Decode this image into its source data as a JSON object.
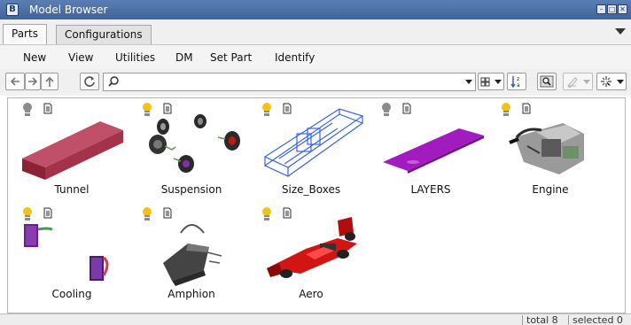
{
  "window": {
    "title": "Model Browser",
    "app_icon": "model-browser-app-icon"
  },
  "tabs": [
    {
      "label": "Parts",
      "active": true
    },
    {
      "label": "Configurations",
      "active": false
    }
  ],
  "menu": [
    "New",
    "View",
    "Utilities",
    "DM",
    "Set Part",
    "Identify"
  ],
  "toolbar": {
    "search_value": "",
    "search_placeholder": "",
    "icons": [
      "back-arrow-icon",
      "forward-arrow-icon",
      "up-arrow-icon",
      "refresh-icon",
      "search-icon",
      "view-mode-icon",
      "sort-az-icon",
      "find-in-model-icon",
      "display-style-icon",
      "selection-filter-icon"
    ]
  },
  "parts": [
    {
      "name": "Tunnel",
      "bulb_on": false,
      "thumb": "tunnel"
    },
    {
      "name": "Suspension",
      "bulb_on": true,
      "thumb": "suspension"
    },
    {
      "name": "Size_Boxes",
      "bulb_on": true,
      "thumb": "sizeboxes"
    },
    {
      "name": "LAYERS",
      "bulb_on": false,
      "thumb": "layers"
    },
    {
      "name": "Engine",
      "bulb_on": true,
      "thumb": "engine"
    },
    {
      "name": "Cooling",
      "bulb_on": true,
      "thumb": "cooling"
    },
    {
      "name": "Amphion",
      "bulb_on": true,
      "thumb": "amphion"
    },
    {
      "name": "Aero",
      "bulb_on": true,
      "thumb": "aero"
    }
  ],
  "status": {
    "total": "total 8",
    "selected": "selected 0"
  },
  "colors": {
    "title_bar": "#4a6fa8",
    "bulb_on": "#f2c21b",
    "bulb_off": "#8a8a8a",
    "tunnel": "#a3324a",
    "layers": "#a21bbf",
    "sizeboxes": "#3a63e6",
    "aero": "#d11414"
  }
}
